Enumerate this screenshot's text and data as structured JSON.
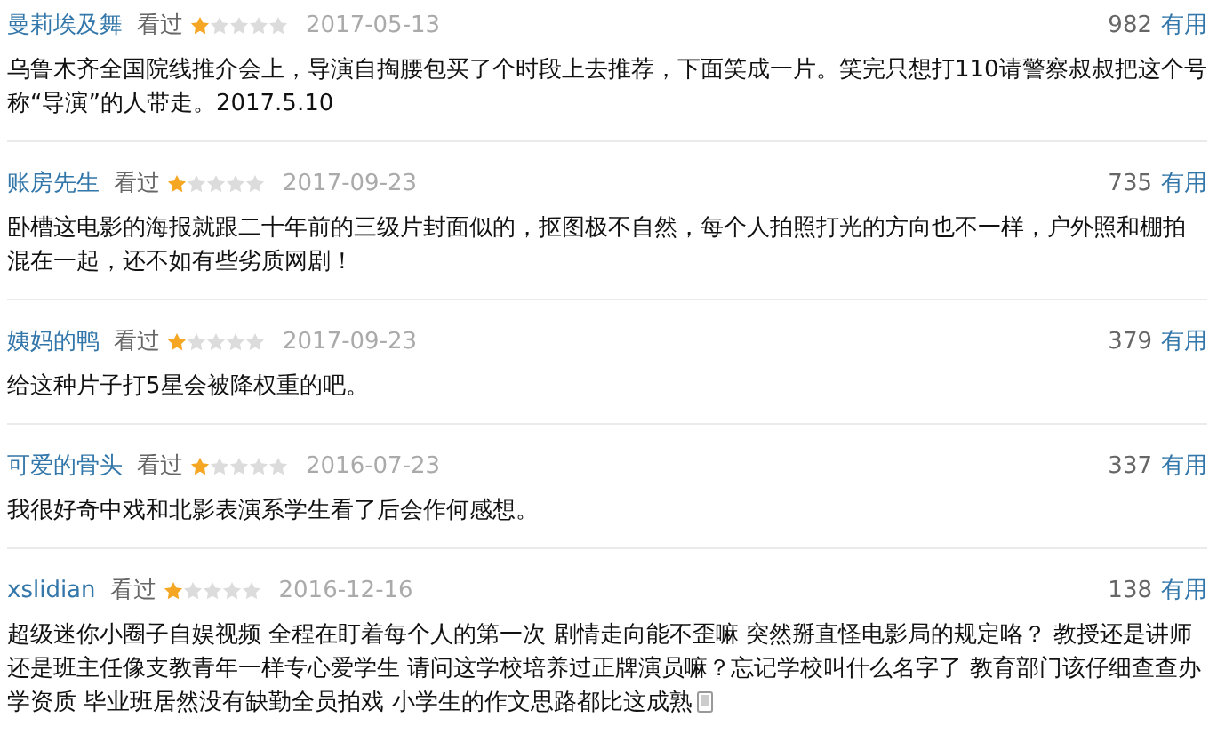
{
  "reviews": [
    {
      "user": "曼莉埃及舞",
      "status": "看过",
      "stars": 1,
      "date": "2017-05-13",
      "votes": "982",
      "vote_label": "有用",
      "text": "乌鲁木齐全国院线推介会上，导演自掏腰包买了个时段上去推荐，下面笑成一片。笑完只想打110请警察叔叔把这个号称“导演”的人带走。2017.5.10",
      "mobile": false
    },
    {
      "user": "账房先生",
      "status": "看过",
      "stars": 1,
      "date": "2017-09-23",
      "votes": "735",
      "vote_label": "有用",
      "text": "卧槽这电影的海报就跟二十年前的三级片封面似的，抠图极不自然，每个人拍照打光的方向也不一样，户外照和棚拍混在一起，还不如有些劣质网剧！",
      "mobile": false
    },
    {
      "user": "姨妈的鸭",
      "status": "看过",
      "stars": 1,
      "date": "2017-09-23",
      "votes": "379",
      "vote_label": "有用",
      "text": "给这种片子打5星会被降权重的吧。",
      "mobile": false
    },
    {
      "user": "可爱的骨头",
      "status": "看过",
      "stars": 1,
      "date": "2016-07-23",
      "votes": "337",
      "vote_label": "有用",
      "text": "我很好奇中戏和北影表演系学生看了后会作何感想。",
      "mobile": false
    },
    {
      "user": "xslidian",
      "status": "看过",
      "stars": 1,
      "date": "2016-12-16",
      "votes": "138",
      "vote_label": "有用",
      "text": "超级迷你小圈子自娱视频 全程在盯着每个人的第一次 剧情走向能不歪嘛 突然掰直怪电影局的规定咯？ 教授还是讲师还是班主任像支教青年一样专心爱学生 请问这学校培养过正牌演员嘛？忘记学校叫什么名字了 教育部门该仔细查查办学资质 毕业班居然没有缺勤全员拍戏 小学生的作文思路都比这成熟",
      "mobile": true
    }
  ]
}
